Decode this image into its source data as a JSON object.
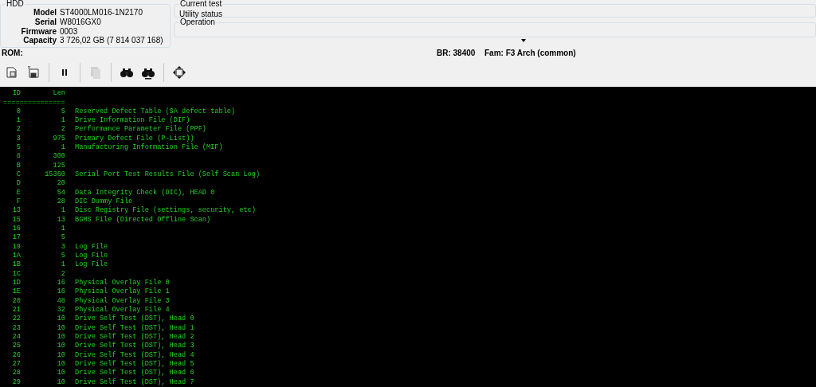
{
  "hdd": {
    "title": "HDD",
    "fields": [
      {
        "label": "Model",
        "value": "ST4000LM016-1N2170"
      },
      {
        "label": "Serial",
        "value": "W8016GX0"
      },
      {
        "label": "Firmware",
        "value": "0003"
      },
      {
        "label": "Capacity",
        "value": "3 726,02 GB (7 814 037 168)"
      }
    ]
  },
  "current_test": {
    "title": "Current test",
    "value": "Utility status"
  },
  "operation": {
    "title": "Operation"
  },
  "status_row": {
    "rom": "ROM:",
    "br": "BR: 38400",
    "fam": "Fam: F3 Arch (common)"
  },
  "toolbar": [
    {
      "kind": "open",
      "disabled": false
    },
    {
      "kind": "save",
      "disabled": false
    },
    {
      "kind": "sep"
    },
    {
      "kind": "pause",
      "disabled": false
    },
    {
      "kind": "sep"
    },
    {
      "kind": "copy",
      "disabled": true
    },
    {
      "kind": "sep"
    },
    {
      "kind": "find",
      "disabled": false
    },
    {
      "kind": "findnext",
      "disabled": false
    },
    {
      "kind": "sep"
    },
    {
      "kind": "move",
      "disabled": false
    }
  ],
  "console": {
    "header": {
      "id": "ID",
      "len": "Len"
    },
    "separator": "===============",
    "rows": [
      {
        "id": "0",
        "len": "5",
        "desc": "Reserved Defect Table (SA defect table)"
      },
      {
        "id": "1",
        "len": "1",
        "desc": "Drive Information File (DIF)"
      },
      {
        "id": "2",
        "len": "2",
        "desc": "Performance Parameter File (PPF)"
      },
      {
        "id": "3",
        "len": "975",
        "desc": "Primary Defect File (P-List))"
      },
      {
        "id": "5",
        "len": "1",
        "desc": "Manufacturing Information File (MIF)"
      },
      {
        "id": "8",
        "len": "300"
      },
      {
        "id": "B",
        "len": "125"
      },
      {
        "id": "C",
        "len": "15360",
        "desc": "Serial Port Test Results File (Self Scan Log)"
      },
      {
        "id": "D",
        "len": "20"
      },
      {
        "id": "E",
        "len": "54",
        "desc": "Data Integrity Check (DIC), HEAD 0"
      },
      {
        "id": "F",
        "len": "28",
        "desc": "DIC Dummy File"
      },
      {
        "id": "13",
        "len": "1",
        "desc": "Disc Registry File (settings, security, etc)"
      },
      {
        "id": "15",
        "len": "13",
        "desc": "BGMS File (Directed Offline Scan)"
      },
      {
        "id": "16",
        "len": "1"
      },
      {
        "id": "17",
        "len": "5"
      },
      {
        "id": "19",
        "len": "3",
        "desc": "Log File"
      },
      {
        "id": "1A",
        "len": "5",
        "desc": "Log File"
      },
      {
        "id": "1B",
        "len": "1",
        "desc": "Log File"
      },
      {
        "id": "1C",
        "len": "2"
      },
      {
        "id": "1D",
        "len": "16",
        "desc": "Physical Overlay File 0"
      },
      {
        "id": "1E",
        "len": "16",
        "desc": "Physical Overlay File 1"
      },
      {
        "id": "20",
        "len": "48",
        "desc": "Physical Overlay File 3"
      },
      {
        "id": "21",
        "len": "32",
        "desc": "Physical Overlay File 4"
      },
      {
        "id": "22",
        "len": "10",
        "desc": "Drive Self Test (DST), Head 0"
      },
      {
        "id": "23",
        "len": "10",
        "desc": "Drive Self Test (DST), Head 1"
      },
      {
        "id": "24",
        "len": "10",
        "desc": "Drive Self Test (DST), Head 2"
      },
      {
        "id": "25",
        "len": "10",
        "desc": "Drive Self Test (DST), Head 3"
      },
      {
        "id": "26",
        "len": "10",
        "desc": "Drive Self Test (DST), Head 4"
      },
      {
        "id": "27",
        "len": "10",
        "desc": "Drive Self Test (DST), Head 5"
      },
      {
        "id": "28",
        "len": "10",
        "desc": "Drive Self Test (DST), Head 6"
      },
      {
        "id": "29",
        "len": "10",
        "desc": "Drive Self Test (DST), Head 7"
      }
    ]
  }
}
